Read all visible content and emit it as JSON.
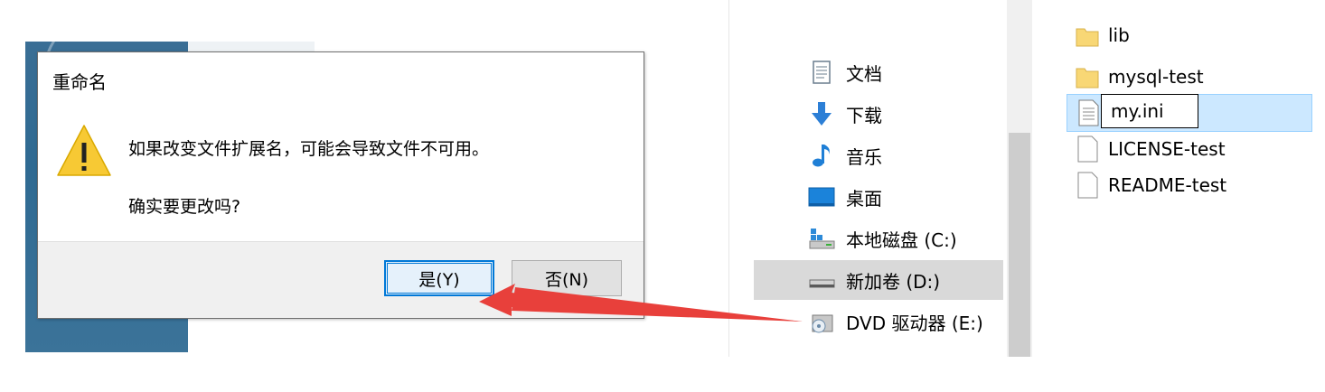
{
  "dialog": {
    "title": "重命名",
    "message": "如果改变文件扩展名，可能会导致文件不可用。",
    "question": "确实要更改吗?",
    "yes_label": "是(Y)",
    "no_label": "否(N)"
  },
  "nav": {
    "items": [
      {
        "label": "文档",
        "icon": "document-icon"
      },
      {
        "label": "下载",
        "icon": "download-icon"
      },
      {
        "label": "音乐",
        "icon": "music-icon"
      },
      {
        "label": "桌面",
        "icon": "desktop-icon"
      },
      {
        "label": "本地磁盘 (C:)",
        "icon": "drive-c-icon"
      },
      {
        "label": "新加卷 (D:)",
        "icon": "drive-icon",
        "selected": true
      },
      {
        "label": "DVD 驱动器 (E:)",
        "icon": "dvd-icon"
      }
    ]
  },
  "files": {
    "items": [
      {
        "name": "lib",
        "type": "folder"
      },
      {
        "name": "mysql-test",
        "type": "folder"
      },
      {
        "name": "my.ini",
        "type": "file",
        "renaming": true
      },
      {
        "name": "LICENSE-test",
        "type": "file"
      },
      {
        "name": "README-test",
        "type": "file"
      }
    ]
  },
  "colors": {
    "accent": "#0078d7",
    "selection": "#cce8ff",
    "arrow": "#e8403b",
    "warning": "#f7c934"
  }
}
